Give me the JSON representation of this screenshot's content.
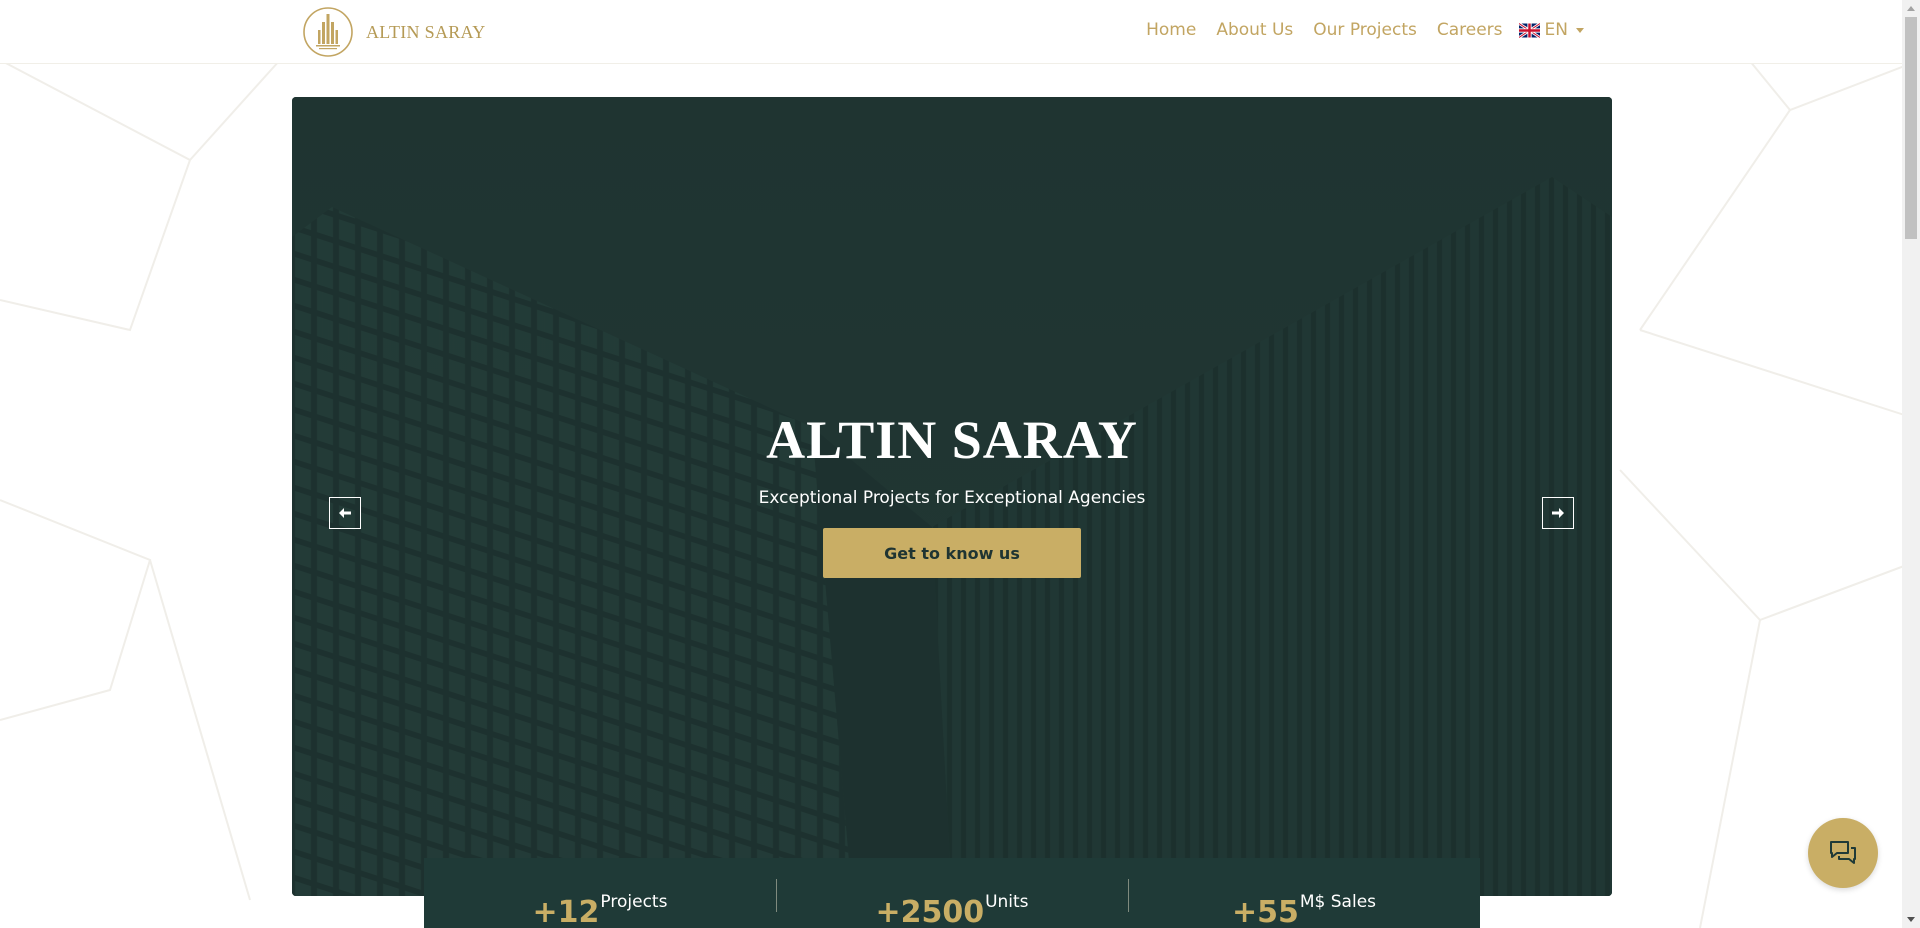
{
  "brand": {
    "name": "ALTIN SARAY",
    "color": "#c2a562"
  },
  "nav": {
    "items": [
      {
        "label": "Home"
      },
      {
        "label": "About Us"
      },
      {
        "label": "Our Projects"
      },
      {
        "label": "Careers"
      }
    ],
    "language": {
      "label": "EN",
      "flag_icon": "uk-flag-icon"
    }
  },
  "hero": {
    "title": "ALTIN SARAY",
    "subtitle": "Exceptional Projects for Exceptional Agencies",
    "cta_label": "Get to know us",
    "prev_icon": "arrow-left-icon",
    "next_icon": "arrow-right-icon"
  },
  "stats": [
    {
      "number": "+12",
      "label": "Projects"
    },
    {
      "number": "+2500",
      "label": "Units"
    },
    {
      "number": "+55",
      "label": "M$ Sales"
    }
  ],
  "chat": {
    "icon": "chat-icon"
  },
  "colors": {
    "accent": "#c9ae65",
    "dark_green": "#1f3a37",
    "white": "#ffffff"
  }
}
